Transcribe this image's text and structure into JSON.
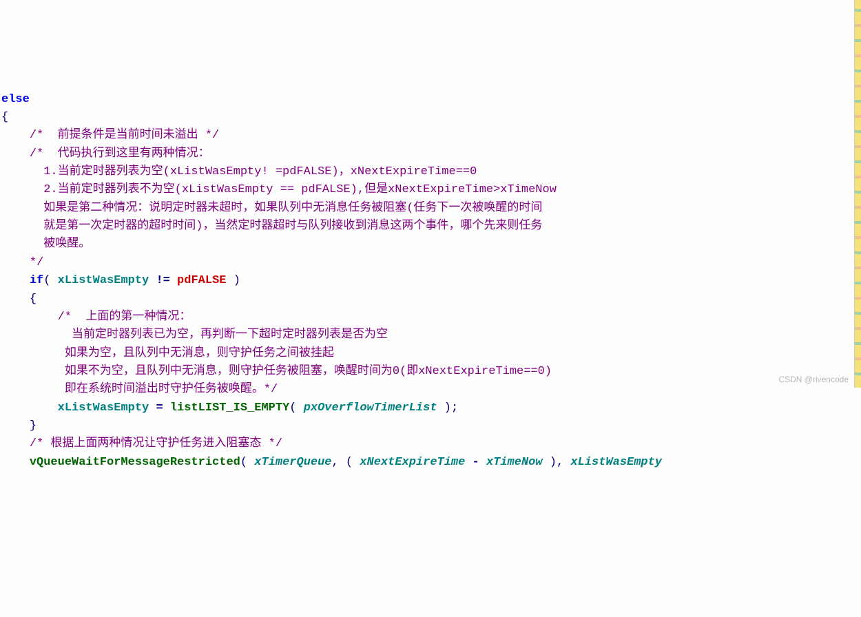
{
  "code": {
    "l01_else": "else",
    "l02_brace": "{",
    "l03_comment": "/*  前提条件是当前时间未溢出 */",
    "l04_comment": "/*  代码执行到这里有两种情况：",
    "l05_comment": "1.当前定时器列表为空(xListWasEmpty! =pdFALSE)，xNextExpireTime==0",
    "l06_comment": "2.当前定时器列表不为空(xListWasEmpty == pdFALSE),但是xNextExpireTime>xTimeNow",
    "l07_comment": "如果是第二种情况：说明定时器未超时，如果队列中无消息任务被阻塞(任务下一次被唤醒的时间",
    "l08_comment": "就是第一次定时器的超时时间)，当然定时器超时与队列接收到消息这两个事件，哪个先来则任务",
    "l09_comment": "被唤醒。",
    "l10_comment": "*/",
    "l11_if": "if",
    "l11_open": "(",
    "l11_var": " xListWasEmpty ",
    "l11_op": "!=",
    "l11_macro": " pdFALSE ",
    "l11_close": ")",
    "l12_brace": "{",
    "l13_comment": "/*  上面的第一种情况：",
    "l14_comment": "当前定时器列表已为空，再判断一下超时定时器列表是否为空",
    "l15_comment": " 如果为空，且队列中无消息，则守护任务之间被挂起",
    "l16_comment": " 如果不为空，且队列中无消息，则守护任务被阻塞，唤醒时间为0(即xNextExpireTime==0)",
    "l17_comment": " 即在系统时间溢出时守护任务被唤醒。*/",
    "l18_lhs": "xListWasEmpty",
    "l18_eq": " = ",
    "l18_fn": "listLIST_IS_EMPTY",
    "l18_open": "(",
    "l18_arg": " pxOverflowTimerList ",
    "l18_close": ")",
    "l18_semi": ";",
    "l19_brace": "}",
    "l20_comment": "/* 根据上面两种情况让守护任务进入阻塞态 */",
    "l21_fn": "vQueueWaitForMessageRestricted",
    "l21_open": "(",
    "l21_arg1": " xTimerQueue",
    "l21_comma1": ",",
    "l21_open2": " (",
    "l21_arg2a": " xNextExpireTime ",
    "l21_minus": "-",
    "l21_arg2b": " xTimeNow ",
    "l21_close2": ")",
    "l21_comma2": ",",
    "l21_arg3": " xListWasEmpty"
  },
  "watermark": "CSDN @rivencode"
}
